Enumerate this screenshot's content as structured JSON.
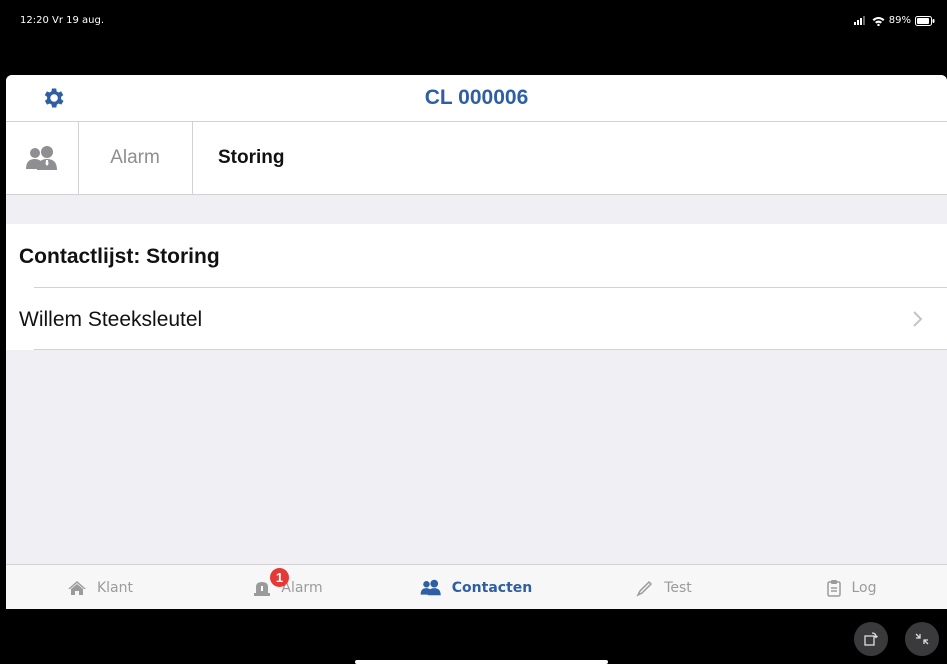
{
  "status_bar": {
    "time": "12:20  Vr 19 aug.",
    "battery": "89%"
  },
  "header": {
    "title": "CL 000006"
  },
  "tabs": {
    "alarm": "Alarm",
    "storing": "Storing"
  },
  "section": {
    "title": "Contactlijst: Storing",
    "contacts": [
      {
        "name": "Willem Steeksleutel"
      }
    ]
  },
  "bottom_nav": {
    "klant": "Klant",
    "alarm": "Alarm",
    "alarm_badge": "1",
    "contacten": "Contacten",
    "test": "Test",
    "log": "Log"
  },
  "colors": {
    "accent": "#2e5fa3",
    "badge": "#e53935"
  },
  "icons": [
    "gear-icon",
    "contacts-icon",
    "chevron-right-icon",
    "home-icon",
    "alarm-icon",
    "test-icon",
    "log-icon",
    "rotate-icon",
    "collapse-icon"
  ]
}
